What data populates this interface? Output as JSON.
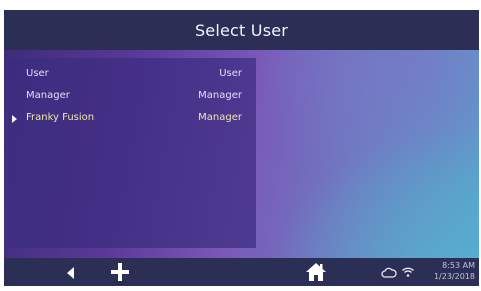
{
  "header": {
    "title": "Select User"
  },
  "users": [
    {
      "name": "User",
      "role": "User",
      "selected": false
    },
    {
      "name": "Manager",
      "role": "Manager",
      "selected": false
    },
    {
      "name": "Franky Fusion",
      "role": "Manager",
      "selected": true
    }
  ],
  "footer": {
    "icons": [
      "back-arrow-icon",
      "plus-icon",
      "home-icon",
      "cloud-icon",
      "wifi-icon"
    ],
    "time": "8:53 AM",
    "date": "1/23/2018"
  },
  "colors": {
    "bar": "#2c2f55",
    "panel": "#3c2c80",
    "selected_text": "#f3e6a2",
    "text": "#e4def3"
  }
}
